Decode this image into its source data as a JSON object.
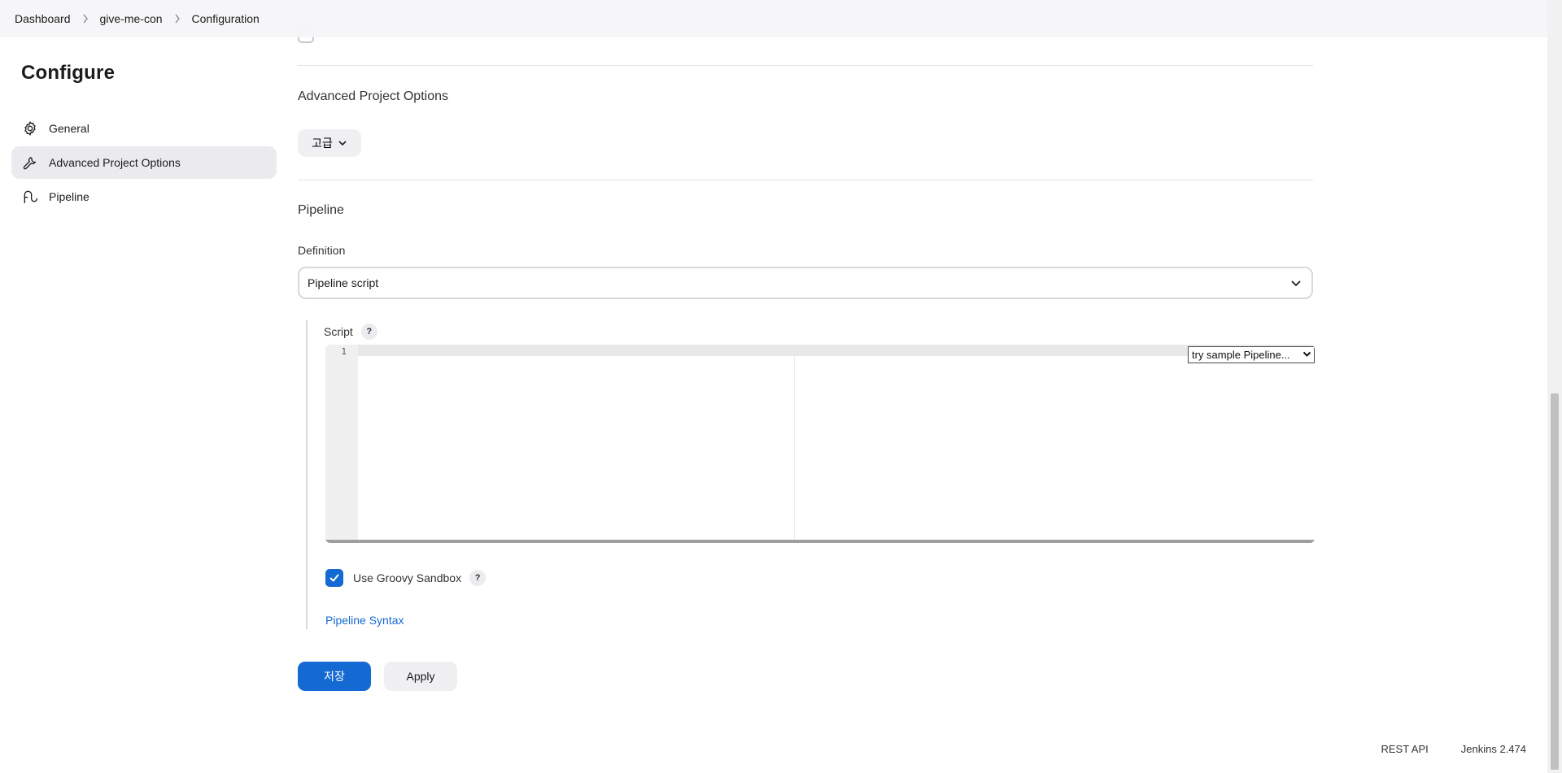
{
  "breadcrumb": {
    "items": [
      "Dashboard",
      "give-me-con",
      "Configuration"
    ]
  },
  "sidebar": {
    "title": "Configure",
    "items": [
      {
        "label": "General",
        "icon": "gear-icon",
        "active": false
      },
      {
        "label": "Advanced Project Options",
        "icon": "wrench-icon",
        "active": true
      },
      {
        "label": "Pipeline",
        "icon": "pipeline-icon",
        "active": false
      }
    ]
  },
  "main": {
    "advanced": {
      "title": "Advanced Project Options",
      "button_label": "고급"
    },
    "pipeline": {
      "title": "Pipeline",
      "definition_label": "Definition",
      "definition_value": "Pipeline script",
      "script_label": "Script",
      "help_glyph": "?",
      "line_number": "1",
      "sample_select_value": "try sample Pipeline...",
      "sandbox_label": "Use Groovy Sandbox",
      "sandbox_checked": true,
      "syntax_link": "Pipeline Syntax"
    },
    "buttons": {
      "save_label": "저장",
      "apply_label": "Apply"
    }
  },
  "footer": {
    "rest_api": "REST API",
    "version": "Jenkins 2.474"
  },
  "colors": {
    "accent": "#1569d2",
    "active_nav_bg": "#ebebef",
    "topbar_bg": "#f6f6f8"
  }
}
